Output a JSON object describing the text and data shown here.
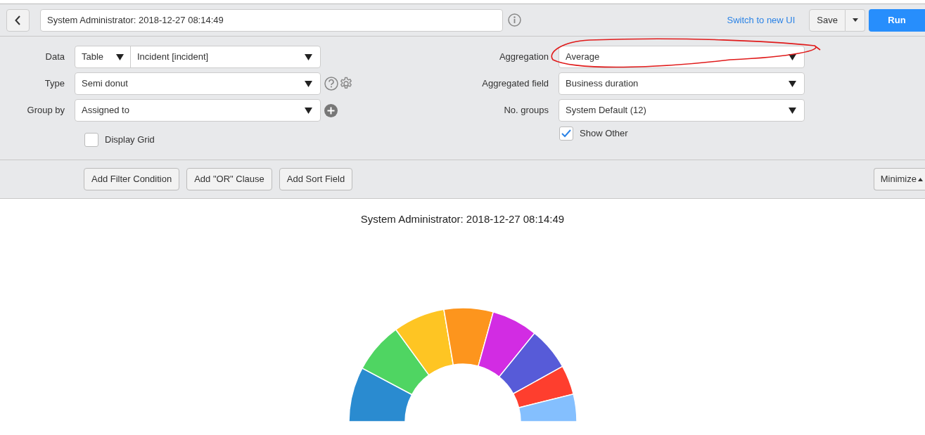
{
  "toolbar": {
    "title_value": "System Administrator: 2018-12-27 08:14:49",
    "switch_link": "Switch to new UI",
    "save_button": "Save",
    "run_button": "Run"
  },
  "form_left": [
    {
      "label": "Data",
      "kind": "split",
      "prefix": "Table",
      "value": "Incident [incident]"
    },
    {
      "label": "Type",
      "kind": "type",
      "value": "Semi donut"
    },
    {
      "label": "Group by",
      "kind": "group",
      "value": "Assigned to"
    }
  ],
  "form_right": [
    {
      "label": "Aggregation",
      "value": "Average"
    },
    {
      "label": "Aggregated field",
      "value": "Business duration"
    },
    {
      "label": "No. groups",
      "value": "System Default (12)"
    }
  ],
  "display_grid": {
    "label": "Display Grid",
    "checked": false
  },
  "show_other": {
    "label": "Show Other",
    "checked": true
  },
  "filter_buttons": [
    "Add Filter Condition",
    "Add \"OR\" Clause",
    "Add Sort Field"
  ],
  "minimize_button": "Minimize",
  "chart": {
    "title": "System Administrator: 2018-12-27 08:14:49"
  }
}
